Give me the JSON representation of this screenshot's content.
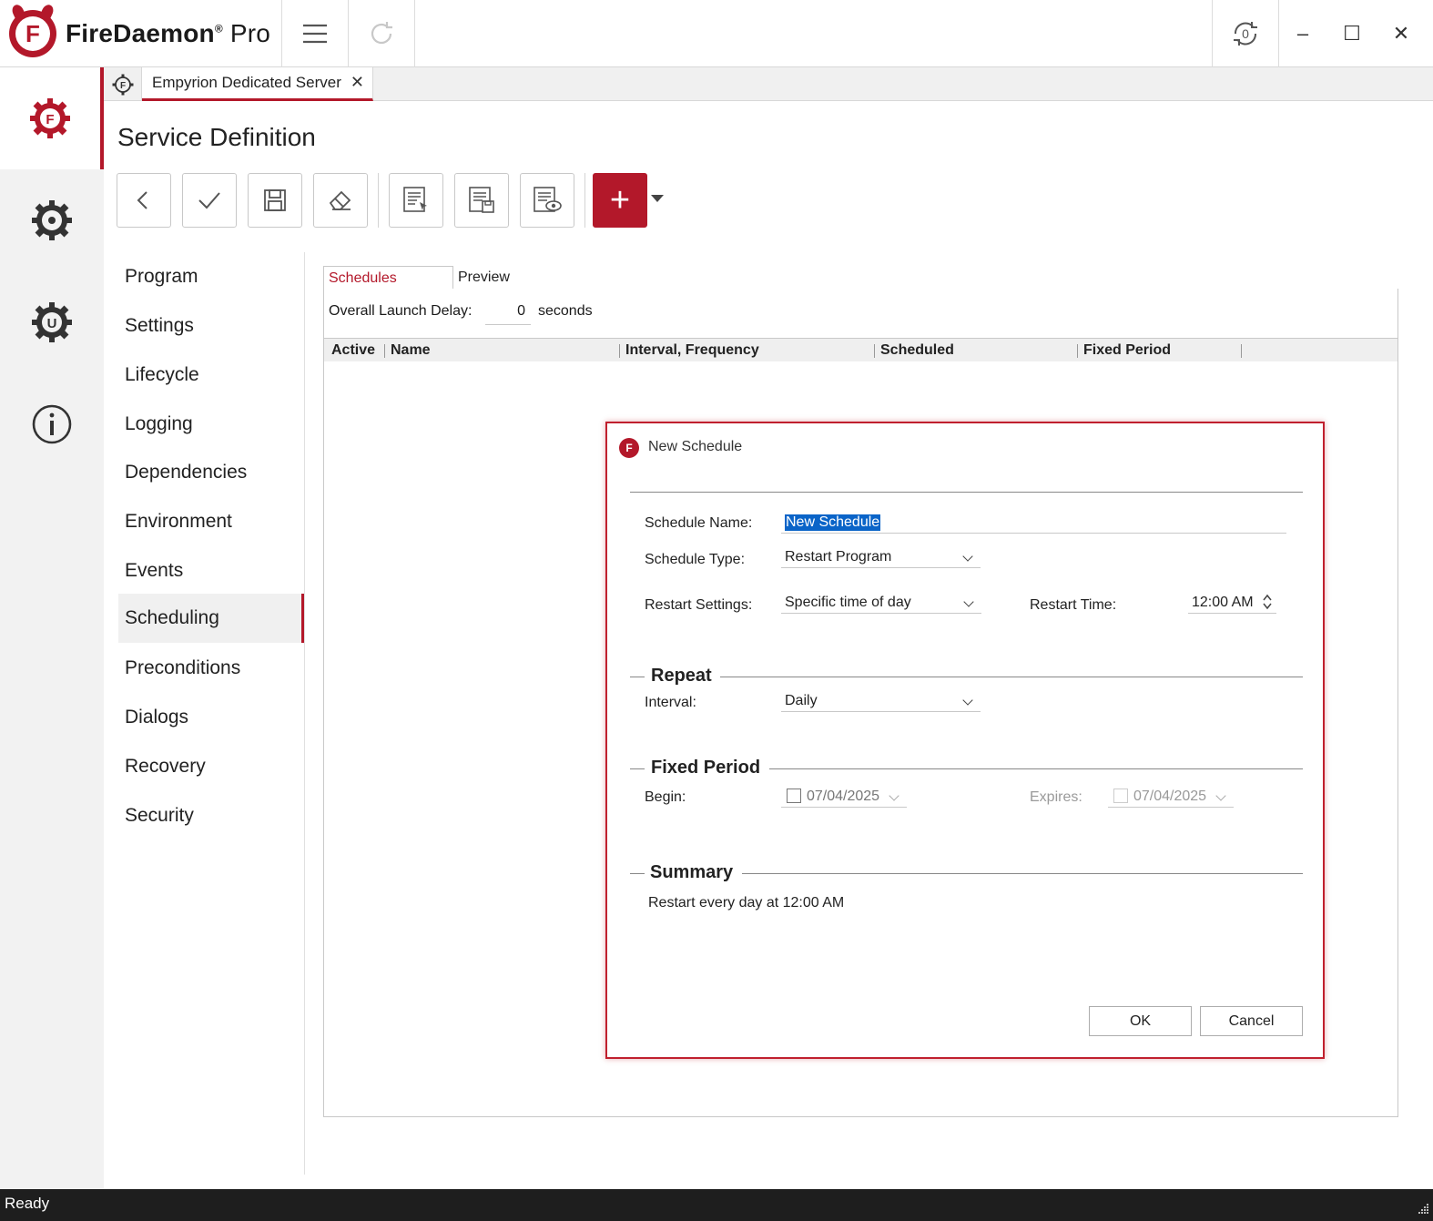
{
  "app": {
    "name": "FireDaemon",
    "edition": "Pro",
    "registered_mark": "®"
  },
  "titlebar": {
    "menu_icon": "hamburger-icon",
    "redo_icon": "redo-icon",
    "refresh_icon": "refresh-icon",
    "minimize": "–",
    "maximize": "☐",
    "close": "✕"
  },
  "rail": {
    "items": [
      {
        "icon": "firedaemon-gear-icon"
      },
      {
        "icon": "settings-gear-icon"
      },
      {
        "icon": "update-gear-icon"
      },
      {
        "icon": "info-icon"
      }
    ]
  },
  "document_tab": {
    "label": "Empyrion Dedicated Server",
    "close": "✕"
  },
  "page": {
    "title": "Service Definition"
  },
  "toolbar": {
    "buttons": [
      "back-icon",
      "check-icon",
      "save-icon",
      "eraser-icon",
      "import-icon",
      "export-icon",
      "preview-icon",
      "add-icon"
    ],
    "add_label": "+"
  },
  "nav": {
    "items": [
      "Program",
      "Settings",
      "Lifecycle",
      "Logging",
      "Dependencies",
      "Environment",
      "Events",
      "Scheduling",
      "Preconditions",
      "Dialogs",
      "Recovery",
      "Security"
    ],
    "active": "Scheduling"
  },
  "tabs": {
    "schedules": "Schedules",
    "preview": "Preview"
  },
  "launch_delay": {
    "label": "Overall Launch Delay:",
    "value": "0",
    "unit": "seconds"
  },
  "grid": {
    "columns": [
      "Active",
      "Name",
      "Interval, Frequency",
      "Scheduled",
      "Fixed Period"
    ]
  },
  "dialog": {
    "title": "New Schedule",
    "schedule_name_label": "Schedule Name:",
    "schedule_name_value": "New Schedule",
    "schedule_type_label": "Schedule Type:",
    "schedule_type_value": "Restart Program",
    "restart_settings_label": "Restart Settings:",
    "restart_settings_value": "Specific time of day",
    "restart_time_label": "Restart Time:",
    "restart_time_value": "12:00 AM",
    "repeat_header": "Repeat",
    "interval_label": "Interval:",
    "interval_value": "Daily",
    "fixed_period_header": "Fixed Period",
    "begin_label": "Begin:",
    "begin_value": "07/04/2025",
    "expires_label": "Expires:",
    "expires_value": "07/04/2025",
    "summary_header": "Summary",
    "summary_text": "Restart every day at 12:00 AM",
    "ok": "OK",
    "cancel": "Cancel"
  },
  "status": {
    "text": "Ready"
  },
  "colors": {
    "accent": "#b3182a",
    "selection": "#0a64c8",
    "statusbar": "#1e1e1e"
  }
}
